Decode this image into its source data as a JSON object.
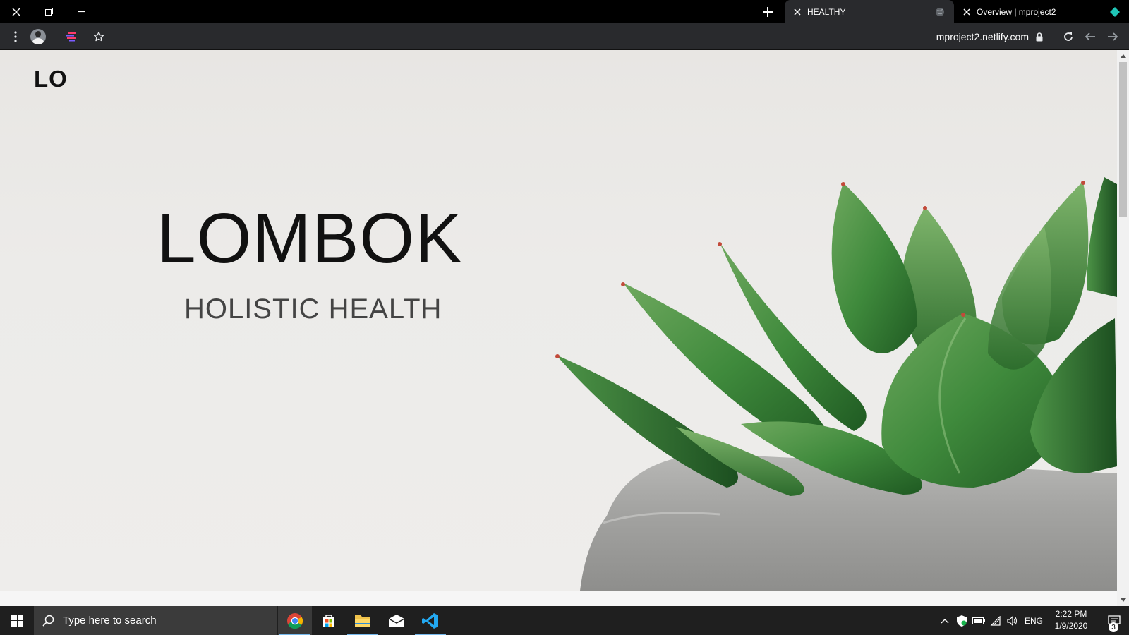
{
  "browser": {
    "tabs": [
      {
        "title": "HEALTHY",
        "active": true
      },
      {
        "title": "Overview | mproject2",
        "active": false
      }
    ],
    "url": "mproject2.netlify.com"
  },
  "page": {
    "logo": "LO",
    "title": "LOMBOK",
    "subtitle": "HOLISTIC HEALTH"
  },
  "taskbar": {
    "search_placeholder": "Type here to search",
    "language": "ENG",
    "time": "2:22 PM",
    "date": "1/9/2020",
    "notification_count": "3",
    "apps": [
      "chrome-icon",
      "store-icon",
      "file-explorer-icon",
      "mail-icon",
      "vscode-icon"
    ]
  },
  "colors": {
    "accent_blue": "#76b9ed",
    "plant_green": "#3f8a3c",
    "page_bg": "#eae8e5"
  }
}
